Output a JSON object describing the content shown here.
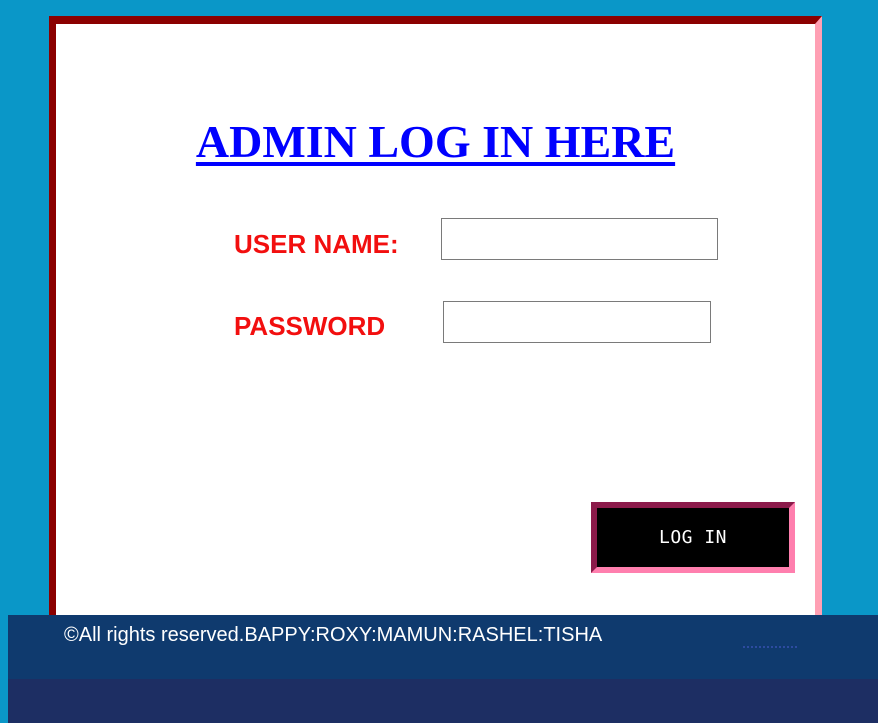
{
  "login": {
    "title": "ADMIN LOG IN HERE",
    "username_label": "USER NAME:",
    "username_value": "",
    "password_label": "PASSWORD",
    "password_value": "",
    "submit_label": "LOG IN"
  },
  "footer": {
    "text": "©All rights reserved.BAPPY:ROXY:MAMUN:RASHEL:TISHA"
  },
  "colors": {
    "background": "#0a97c8",
    "panel": "#ffffff",
    "title": "#0000ff",
    "labels": "#f20f0f",
    "button": "#000000",
    "footer": "#1d2e63"
  }
}
